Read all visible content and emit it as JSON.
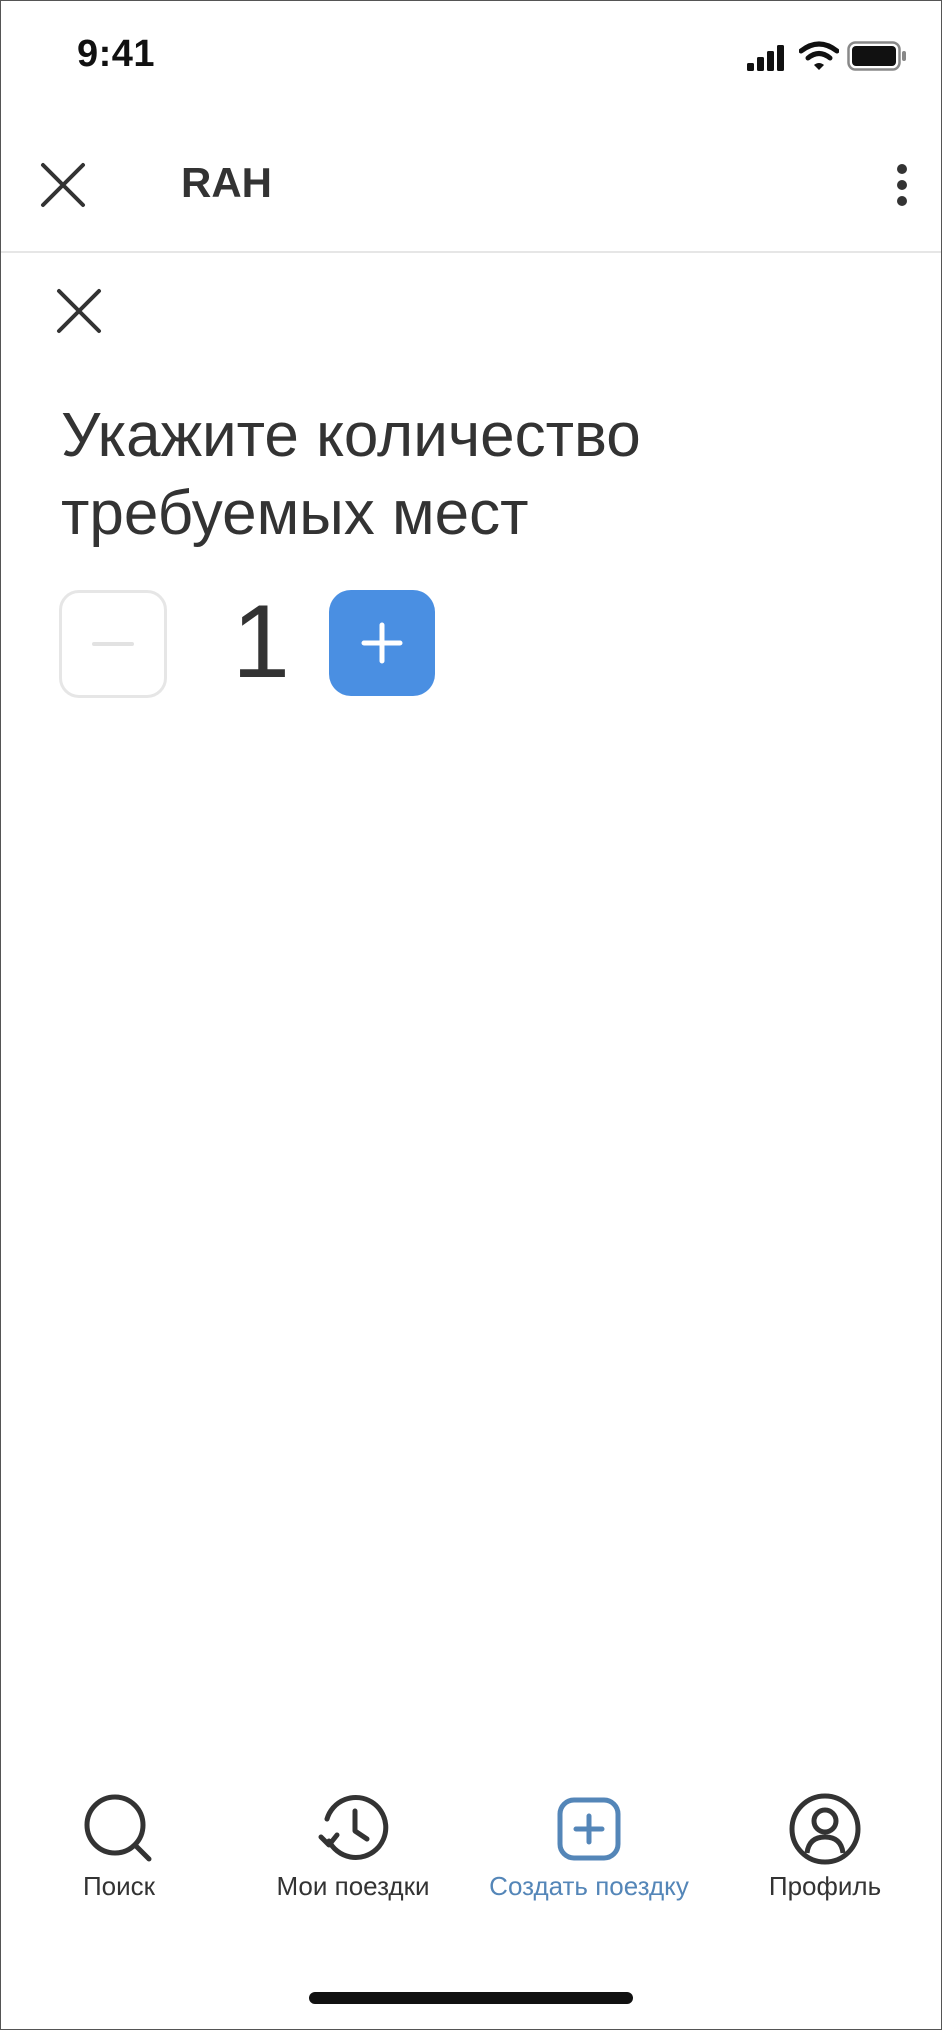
{
  "status_bar": {
    "time": "9:41"
  },
  "header": {
    "title": "RAH"
  },
  "content": {
    "prompt_line1": "Укажите количество",
    "prompt_line2": "требуемых мест",
    "seats_count": "1"
  },
  "bottom_nav": {
    "items": [
      {
        "label": "Поиск",
        "icon": "search-icon"
      },
      {
        "label": "Мои поездки",
        "icon": "history-icon"
      },
      {
        "label": "Создать поездку",
        "icon": "add-square-icon",
        "active": true
      },
      {
        "label": "Профиль",
        "icon": "profile-icon"
      }
    ]
  },
  "colors": {
    "accent": "#4a8fe2",
    "active_nav": "#5486b8",
    "text": "#333333",
    "disabled_border": "#e6e6e6"
  }
}
